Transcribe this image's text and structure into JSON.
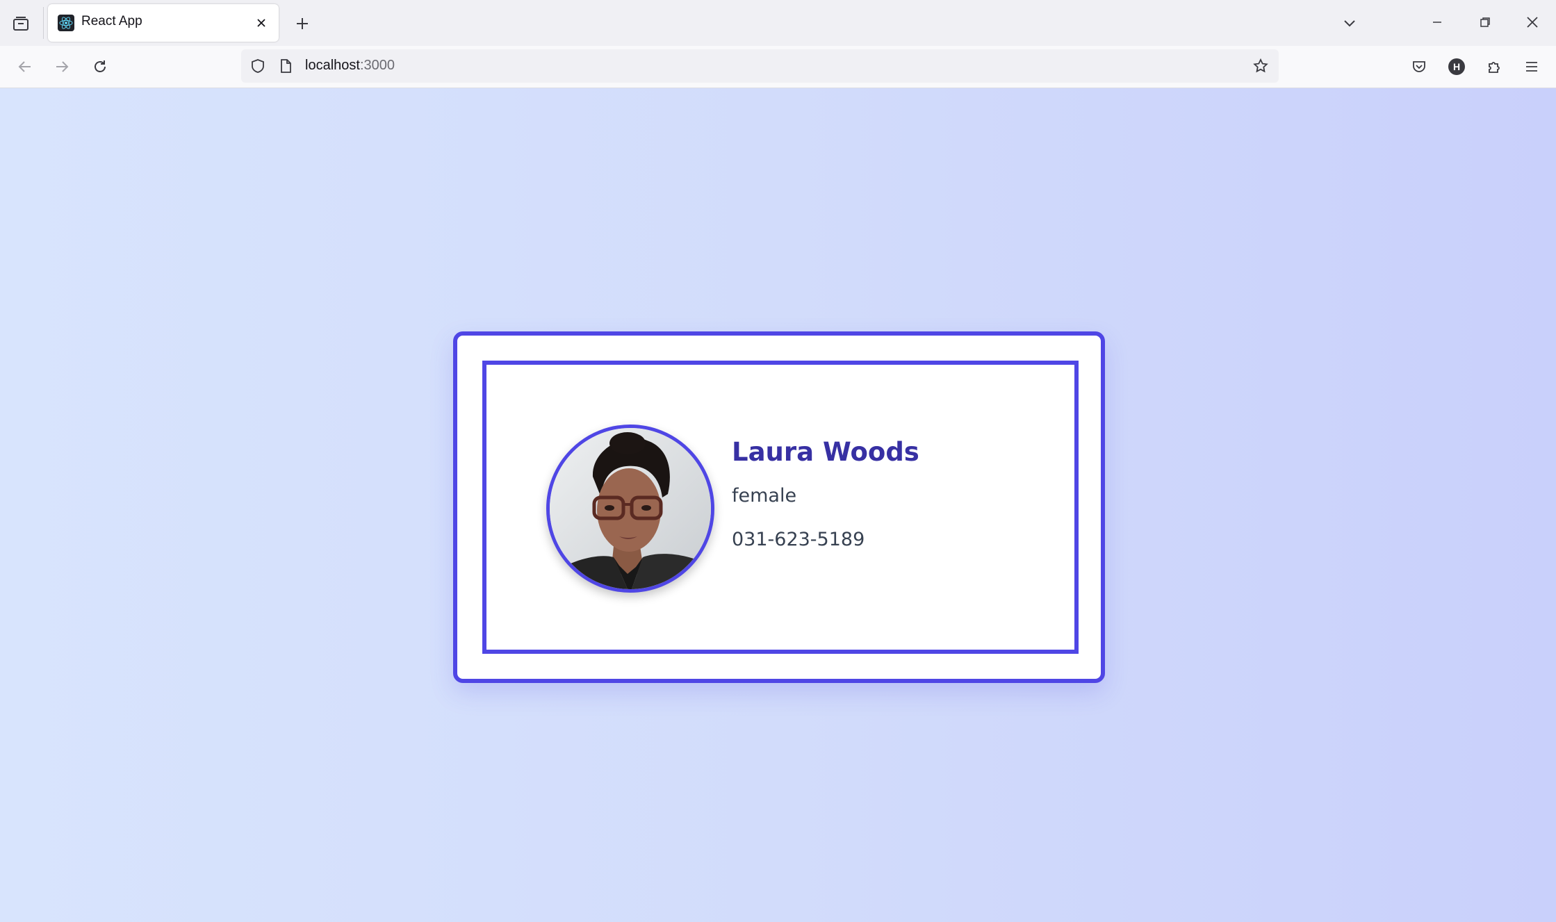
{
  "browser": {
    "tab": {
      "title": "React App",
      "favicon": "react-logo-icon"
    },
    "url": {
      "host": "localhost",
      "port": ":3000"
    },
    "profile_initial": "H",
    "icons": {
      "tab_overview": "tab-overview-icon",
      "close_tab": "close-icon",
      "new_tab": "plus-icon",
      "list_tabs": "chevron-down-icon",
      "minimize": "minimize-icon",
      "restore": "restore-icon",
      "close_window": "close-icon",
      "back": "back-arrow-icon",
      "forward": "forward-arrow-icon",
      "reload": "reload-icon",
      "shield": "shield-icon",
      "page": "page-icon",
      "bookmark": "star-icon",
      "pocket": "pocket-icon",
      "extensions": "puzzle-icon",
      "menu": "hamburger-menu-icon"
    }
  },
  "profile_card": {
    "name": "Laura Woods",
    "gender": "female",
    "phone": "031-623-5189",
    "photo": "profile-photo"
  },
  "colors": {
    "accent": "#4f46e5",
    "name_text": "#3730a3",
    "body_text": "#374151",
    "background_start": "#d8e4fd",
    "background_end": "#c9d0fb"
  }
}
